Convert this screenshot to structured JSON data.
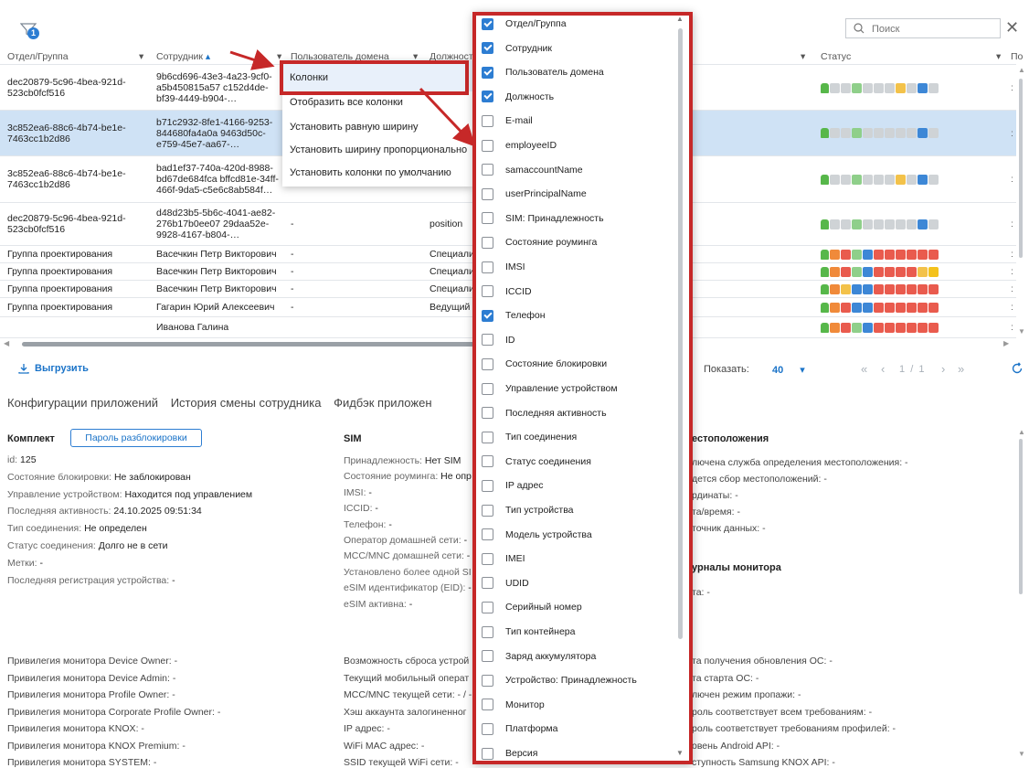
{
  "search": {
    "placeholder": "Поиск"
  },
  "filter_badge": "1",
  "columns": {
    "group": "Отдел/Группа",
    "employee": "Сотрудник",
    "domain_user": "Пользователь домена",
    "position": "Должност",
    "status": "Статус",
    "extra": "По"
  },
  "rows": [
    {
      "group": [
        "dec20879-5c96-4bea-921d-",
        "523cb0fcf516"
      ],
      "employee": [
        "9b6cd696-43e3-4a23-9cf0-",
        "a5b450815a57 c152d4de-",
        "bf39-4449-b904-…"
      ],
      "domain": "",
      "position": "",
      "selected": false
    },
    {
      "group": [
        "3c852ea6-88c6-4b74-be1e-",
        "7463cc1b2d86"
      ],
      "employee": [
        "b71c2932-8fe1-4166-9253-",
        "844680fa4a0a 9463d50c-",
        "e759-45e7-aa67-…"
      ],
      "domain": "",
      "position": "",
      "selected": true
    },
    {
      "group": [
        "3c852ea6-88c6-4b74-be1e-",
        "7463cc1b2d86"
      ],
      "employee": [
        "bad1ef37-740a-420d-8988-",
        "bd67de684fca bffcd81e-34ff-",
        "466f-9da5-c5e6c8ab584f…"
      ],
      "domain": "",
      "position": "",
      "selected": false
    },
    {
      "group": [
        "dec20879-5c96-4bea-921d-",
        "523cb0fcf516"
      ],
      "employee": [
        "d48d23b5-5b6c-4041-ae82-",
        "276b17b0ee07 29daa52e-",
        "9928-4167-b804-…"
      ],
      "domain": "-",
      "position": "position",
      "selected": false
    },
    {
      "group": [
        "Группа проектирования"
      ],
      "employee": [
        "Васечкин Петр Викторович"
      ],
      "domain": "-",
      "position": "Специали",
      "selected": false
    },
    {
      "group": [
        "Группа проектирования"
      ],
      "employee": [
        "Васечкин Петр Викторович"
      ],
      "domain": "-",
      "position": "Специали",
      "selected": false
    },
    {
      "group": [
        "Группа проектирования"
      ],
      "employee": [
        "Васечкин Петр Викторович"
      ],
      "domain": "-",
      "position": "Специали",
      "selected": false
    },
    {
      "group": [
        "Группа проектирования"
      ],
      "employee": [
        "Гагарин Юрий Алексеевич"
      ],
      "domain": "-",
      "position": "Ведущий",
      "selected": false
    },
    {
      "group": [
        ""
      ],
      "employee": [
        "Иванова Галина"
      ],
      "domain": "",
      "position": "",
      "selected": false
    }
  ],
  "context_menu": {
    "columns": "Колонки",
    "show_all": "Отобразить все колонки",
    "equal_width": "Установить равную ширину",
    "proportional_width": "Установить ширину пропорционально",
    "default_columns": "Установить колонки по умолчанию"
  },
  "column_options": [
    {
      "label": "Отдел/Группа",
      "checked": true
    },
    {
      "label": "Сотрудник",
      "checked": true
    },
    {
      "label": "Пользователь домена",
      "checked": true
    },
    {
      "label": "Должность",
      "checked": true
    },
    {
      "label": "E-mail",
      "checked": false
    },
    {
      "label": "employeeID",
      "checked": false
    },
    {
      "label": "samaccountName",
      "checked": false
    },
    {
      "label": "userPrincipalName",
      "checked": false
    },
    {
      "label": "SIM: Принадлежность",
      "checked": false
    },
    {
      "label": "Состояние роуминга",
      "checked": false
    },
    {
      "label": "IMSI",
      "checked": false
    },
    {
      "label": "ICCID",
      "checked": false
    },
    {
      "label": "Телефон",
      "checked": true
    },
    {
      "label": "ID",
      "checked": false
    },
    {
      "label": "Состояние блокировки",
      "checked": false
    },
    {
      "label": "Управление устройством",
      "checked": false
    },
    {
      "label": "Последняя активность",
      "checked": false
    },
    {
      "label": "Тип соединения",
      "checked": false
    },
    {
      "label": "Статус соединения",
      "checked": false
    },
    {
      "label": "IP адрес",
      "checked": false
    },
    {
      "label": "Тип устройства",
      "checked": false
    },
    {
      "label": "Модель устройства",
      "checked": false
    },
    {
      "label": "IMEI",
      "checked": false
    },
    {
      "label": "UDID",
      "checked": false
    },
    {
      "label": "Серийный номер",
      "checked": false
    },
    {
      "label": "Тип контейнера",
      "checked": false
    },
    {
      "label": "Заряд аккумулятора",
      "checked": false
    },
    {
      "label": "Устройство: Принадлежность",
      "checked": false
    },
    {
      "label": "Монитор",
      "checked": false
    },
    {
      "label": "Платформа",
      "checked": false
    },
    {
      "label": "Версия",
      "checked": false
    }
  ],
  "toolbar": {
    "export": "Выгрузить",
    "show_label": "Показать:",
    "page_size": "40",
    "pagination": "1  /  1"
  },
  "tabs": [
    "Конфигурации приложений",
    "История смены сотрудника",
    "Фидбэк приложен"
  ],
  "kit": {
    "title": "Комплект",
    "unlock_button": "Пароль разблокировки",
    "fields": [
      {
        "label": "id:",
        "value": "125"
      },
      {
        "label": "Состояние блокировки:",
        "value": "Не заблокирован"
      },
      {
        "label": "Управление устройством:",
        "value": "Находится под управлением"
      },
      {
        "label": "Последняя активность:",
        "value": "24.10.2025 09:51:34"
      },
      {
        "label": "Тип соединения:",
        "value": "Не определен"
      },
      {
        "label": "Статус соединения:",
        "value": "Долго не в сети"
      },
      {
        "label": "Метки:",
        "value": "-"
      },
      {
        "label": "Последняя регистрация устройства:",
        "value": "-"
      }
    ],
    "privileges": [
      "Привилегия монитора Device Owner: -",
      "Привилегия монитора Device Admin: -",
      "Привилегия монитора Profile Owner: -",
      "Привилегия монитора Corporate Profile Owner: -",
      "Привилегия монитора KNOX: -",
      "Привилегия монитора KNOX Premium: -",
      "Привилегия монитора SYSTEM: -"
    ]
  },
  "sim": {
    "title": "SIM",
    "fields": [
      {
        "label": "Принадлежность:",
        "value": "Нет SIM"
      },
      {
        "label": "Состояние роуминга:",
        "value": "Не опр"
      },
      {
        "label": "IMSI:",
        "value": "-"
      },
      {
        "label": "ICCID:",
        "value": "-"
      },
      {
        "label": "Телефон:",
        "value": "-"
      },
      {
        "label": "Оператор домашней сети:",
        "value": "-"
      },
      {
        "label": "MCC/MNC домашней сети:",
        "value": "-"
      },
      {
        "label": "Установлено более одной SI",
        "value": ""
      },
      {
        "label": "eSIM идентификатор (EID):",
        "value": "-"
      },
      {
        "label": "eSIM активна:",
        "value": "-"
      }
    ],
    "more": [
      "Возможность сброса устрой",
      "Текущий мобильный операт",
      "MCC/MNC текущей сети: - / -",
      "Хэш аккаунта залогиненног",
      "IP адрес: -",
      "WiFi MAC адрес: -",
      "SSID текущей WiFi сети: -"
    ]
  },
  "location": {
    "title": "естоположения",
    "fields": [
      "лючена служба определения местоположения: -",
      "дется сбор местоположений: -",
      "рдинаты: -",
      "та/время: -",
      "точник данных: -"
    ],
    "monitor_title": "урналы монитора",
    "monitor_fields": [
      "та: -"
    ],
    "more": [
      "та получения обновления ОС: -",
      "та старта ОС: -",
      "лючен режим пропажи: -",
      "роль соответствует всем требованиям: -",
      "роль соответствует требованиям профилей: -",
      "овень Android API: -",
      "ступность Samsung KNOX API: -"
    ]
  },
  "colors": {
    "accent": "#2d7dd2",
    "highlight": "#c62828",
    "selected_row": "#cfe2f5"
  }
}
